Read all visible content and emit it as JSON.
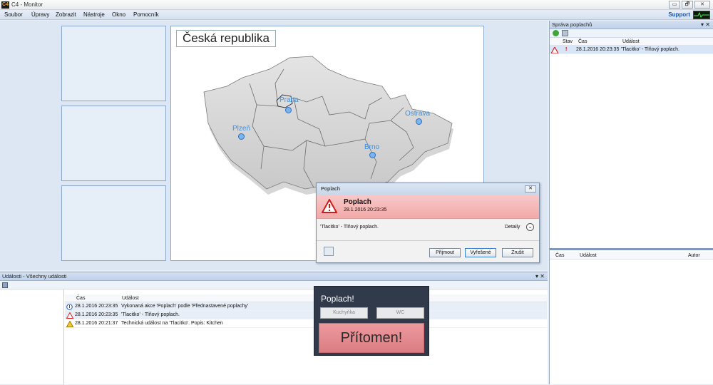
{
  "window": {
    "title": "C4 - Monitor",
    "app_icon_text": "C4",
    "controls": [
      "▭",
      "🗗",
      "✕"
    ]
  },
  "menu": {
    "items": [
      "Soubor",
      "Úpravy",
      "Zobrazit",
      "Nástroje",
      "Okno",
      "Pomocník"
    ],
    "support": "Support"
  },
  "map": {
    "title": "Česká republika",
    "cities": [
      {
        "name": "Praha"
      },
      {
        "name": "Plzeň"
      },
      {
        "name": "Ostrava"
      },
      {
        "name": "Brno"
      }
    ]
  },
  "alarm_panel": {
    "title": "Správa poplachů",
    "pin": "▾ ✕",
    "columns": [
      "Stav",
      "Čas",
      "Událost"
    ],
    "rows": [
      {
        "state": "!",
        "time": "28.1.2016 20:23:35",
        "event": "'Tlacitko' - Tlňový poplach."
      }
    ],
    "lower_columns": [
      "Čas",
      "Událost",
      "Autor"
    ]
  },
  "events_panel": {
    "title": "Události - Všechny události",
    "pin": "▾ ✕",
    "columns": [
      "Čas",
      "Událost"
    ],
    "rows": [
      {
        "time": "28.1.2016 20:23:35",
        "event": "Vykonaná akce 'Poplach' podle 'Přednastavené poplachy'",
        "icon": "info"
      },
      {
        "time": "28.1.2016 20:23:35",
        "event": "'Tlacitko' - Tlňový poplach.",
        "icon": "alarm"
      },
      {
        "time": "28.1.2016 20:21:37",
        "event": "Technická událost na 'Tlacitko'. Popis: Kitchen",
        "icon": "warning"
      }
    ]
  },
  "dialog": {
    "title": "Poplach",
    "close": "✕",
    "heading": "Poplach",
    "timestamp": "28.1.2016 20:23:35",
    "message": "'Tlacitko' - Tlňový poplach.",
    "details": "Detaily",
    "buttons": {
      "accept": "Přijmout",
      "resolved": "Vyřešené",
      "cancel": "Zrušit"
    }
  },
  "popup": {
    "title": "Poplach!",
    "option1": "Kuchyňka",
    "option2": "WC",
    "confirm": "Přítomen!"
  },
  "colors": {
    "accent": "#2a6fc7",
    "alarm": "#f2a9a9",
    "popup_bg": "#303a4a"
  }
}
